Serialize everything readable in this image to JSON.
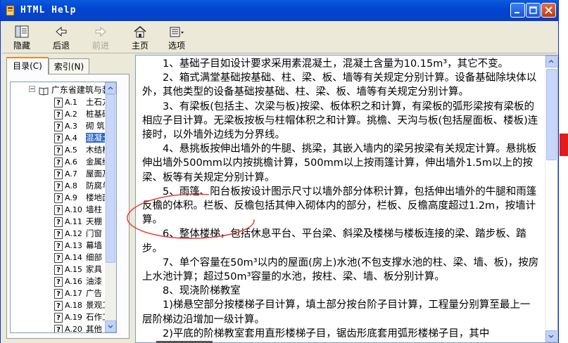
{
  "window": {
    "title": "HTML Help"
  },
  "toolbar": {
    "buttons": [
      {
        "id": "hide",
        "label": "隐藏",
        "icon": "hide-icon"
      },
      {
        "id": "back",
        "label": "后退",
        "icon": "back-arrow-icon"
      },
      {
        "id": "forward",
        "label": "前进",
        "icon": "forward-arrow-icon"
      },
      {
        "id": "home",
        "label": "主页",
        "icon": "home-icon"
      },
      {
        "id": "options",
        "label": "选项",
        "icon": "options-icon"
      }
    ]
  },
  "nav": {
    "tabs": [
      {
        "label": "目录(C)"
      },
      {
        "label": "索引(N)"
      }
    ],
    "tree": {
      "root": "广东省建筑与装",
      "items": [
        {
          "code": "A.1",
          "label": "土石方"
        },
        {
          "code": "A.2",
          "label": "桩基础"
        },
        {
          "code": "A.3",
          "label": "砌  筑"
        },
        {
          "code": "A.4",
          "label": "混凝土"
        },
        {
          "code": "A.5",
          "label": "木结构"
        },
        {
          "code": "A.6",
          "label": "金属结"
        },
        {
          "code": "A.7",
          "label": "屋面及"
        },
        {
          "code": "A.8",
          "label": "防腐与"
        },
        {
          "code": "A.9",
          "label": "楼地面"
        },
        {
          "code": "A.10",
          "label": "墙柱"
        },
        {
          "code": "A.11",
          "label": "天棚"
        },
        {
          "code": "A.12",
          "label": "门窗"
        },
        {
          "code": "A.13",
          "label": "幕墙"
        },
        {
          "code": "A.14",
          "label": "细部"
        },
        {
          "code": "A.15",
          "label": "家具"
        },
        {
          "code": "A.16",
          "label": "油漆"
        },
        {
          "code": "A.17",
          "label": "广告"
        },
        {
          "code": "A.18",
          "label": "景观工"
        },
        {
          "code": "A.19",
          "label": "石作工"
        },
        {
          "code": "A.20",
          "label": "其他"
        }
      ]
    }
  },
  "content": {
    "paragraphs": [
      "1、基础子目如设计要求采用素混凝土，混凝土含量为10.15m³，其它不变。",
      "2、箱式满堂基础按基础、柱、梁、板、墙等有关规定分别计算。设备基础除块体以外，其他类型的设备基础按基础、柱、梁、板、墙等有关规定分别计算。",
      "3、有梁板(包括主、次梁与板)按梁、板体积之和计算，有梁板的弧形梁按有梁板的相应子目计算。无梁板按板与柱帽体积之和计算。挑檐、天沟与板(包括屋面板、楼板)连接时，以外墙外边线为分界线。",
      "4、悬挑板按伸出墙外的牛腿、挑梁，其嵌入墙内的梁另按梁有关规定计算。悬挑板伸出墙外500mm以内按挑檐计算，500mm以上按雨篷计算，伸出墙外1.5m以上的按梁、板等有关规定分别计算。",
      "5、雨篷、阳台板按设计图示尺寸以墙外部分体积计算，包括伸出墙外的牛腿和雨篷反檐的体积。栏板、反檐包括其伸入砌体内的部分，栏板、反檐高度超过1.2m，按墙计算。",
      "6、整体楼梯，包括休息平台、平台梁、斜梁及楼梯与楼板连接的梁、踏步板、踏步。",
      "7、单个容量在50m³以内的屋面(房上)水池(不包支撑水池的柱、梁、墙、板)，按房上水池计算；超过50m³容量的水池，按柱、梁、墙、板分别计算。",
      "8、现浇阶梯教室",
      "1)梯悬空部分按楼梯子目计算，填土部分按台阶子目计算，工程量分别算至最上一层阶梯边沿增加一级计算。",
      "2)平底的阶梯教室套用直形楼梯子目，锯齿形底套用弧形楼梯子目，其中"
    ]
  },
  "colors": {
    "titlebar": "#0046d5",
    "selection": "#316ac5",
    "annotation": "#e0443c"
  }
}
